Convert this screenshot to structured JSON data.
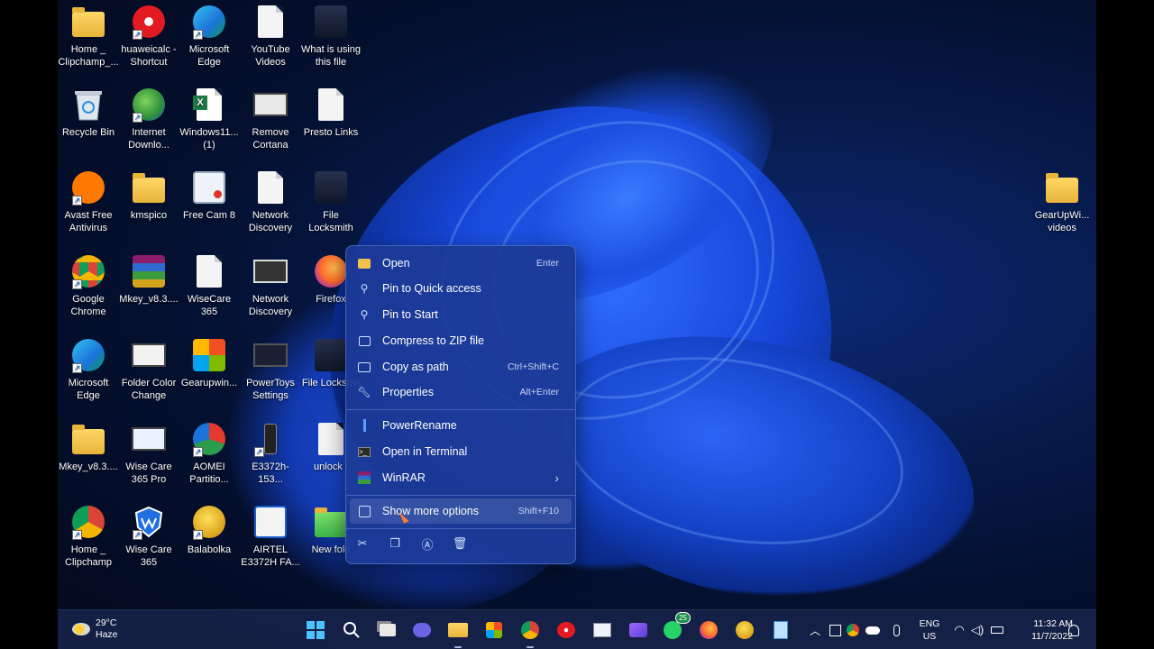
{
  "desktop": {
    "icons": [
      {
        "label": "Home _ Clipchamp_...",
        "icon": "folder-icon"
      },
      {
        "label": "huaweicalc - Shortcut",
        "icon": "huawei-icon"
      },
      {
        "label": "Microsoft Edge",
        "icon": "edge-icon"
      },
      {
        "label": "YouTube Videos",
        "icon": "document-icon"
      },
      {
        "label": "What is using this file",
        "icon": "app-icon"
      },
      {
        "label": "Recycle Bin",
        "icon": "recycle-bin-icon"
      },
      {
        "label": "Internet Downlo...",
        "icon": "idm-icon"
      },
      {
        "label": "Windows11... (1)",
        "icon": "excel-icon"
      },
      {
        "label": "Remove Cortana",
        "icon": "screen-icon"
      },
      {
        "label": "Presto Links",
        "icon": "document-icon"
      },
      {
        "label": "Avast Free Antivirus",
        "icon": "avast-icon"
      },
      {
        "label": "kmspico",
        "icon": "folder-icon"
      },
      {
        "label": "Free Cam 8",
        "icon": "freecam-icon"
      },
      {
        "label": "Network Discovery",
        "icon": "document-icon"
      },
      {
        "label": "File Locksmith",
        "icon": "app-icon"
      },
      {
        "label": "Google Chrome",
        "icon": "chrome-icon"
      },
      {
        "label": "Mkey_v8.3....",
        "icon": "winrar-icon"
      },
      {
        "label": "WiseCare 365",
        "icon": "document-icon"
      },
      {
        "label": "Network Discovery",
        "icon": "video-icon"
      },
      {
        "label": "Firefox",
        "icon": "firefox-icon"
      },
      {
        "label": "Microsoft Edge",
        "icon": "edge-icon"
      },
      {
        "label": "Folder Color Change",
        "icon": "screen-icon"
      },
      {
        "label": "Gearupwin...",
        "icon": "gearup-icon"
      },
      {
        "label": "PowerToys Settings",
        "icon": "screen-icon"
      },
      {
        "label": "File Locksmit",
        "icon": "app-icon"
      },
      {
        "label": "Mkey_v8.3....",
        "icon": "folder-icon"
      },
      {
        "label": "Wise Care 365 Pro",
        "icon": "screen-icon"
      },
      {
        "label": "AOMEI Partitio...",
        "icon": "aomei-icon"
      },
      {
        "label": "E3372h-153...",
        "icon": "modem-icon"
      },
      {
        "label": "unlock f",
        "icon": "document-icon"
      },
      {
        "label": "Home _ Clipchamp",
        "icon": "chrome-icon"
      },
      {
        "label": "Wise Care 365",
        "icon": "wisecare-icon"
      },
      {
        "label": "Balabolka",
        "icon": "balabolka-icon"
      },
      {
        "label": "AIRTEL E3372H FA...",
        "icon": "airtel-icon"
      },
      {
        "label": "New fold",
        "icon": "green-folder-icon"
      },
      {
        "label": "GearUpWi... videos",
        "icon": "folder-icon"
      }
    ]
  },
  "context_menu": {
    "items": [
      {
        "label": "Open",
        "shortcut": "Enter",
        "icon": "folder-open-icon"
      },
      {
        "label": "Pin to Quick access",
        "shortcut": "",
        "icon": "pin-icon"
      },
      {
        "label": "Pin to Start",
        "shortcut": "",
        "icon": "pin-icon"
      },
      {
        "label": "Compress to ZIP file",
        "shortcut": "",
        "icon": "zip-icon"
      },
      {
        "label": "Copy as path",
        "shortcut": "Ctrl+Shift+C",
        "icon": "path-icon"
      },
      {
        "label": "Properties",
        "shortcut": "Alt+Enter",
        "icon": "wrench-icon"
      },
      {
        "label": "PowerRename",
        "shortcut": "",
        "icon": "powerrename-icon"
      },
      {
        "label": "Open in Terminal",
        "shortcut": "",
        "icon": "terminal-icon"
      },
      {
        "label": "WinRAR",
        "shortcut": "",
        "icon": "winrar-icon"
      },
      {
        "label": "Show more options",
        "shortcut": "Shift+F10",
        "icon": "more-options-icon"
      }
    ],
    "winrar_arrow": "›",
    "bottom_actions": [
      "cut-icon",
      "copy-icon",
      "rename-icon",
      "delete-icon"
    ]
  },
  "taskbar": {
    "weather_temp": "29°C",
    "weather_desc": "Haze",
    "whatsapp_badge": "25",
    "lang_top": "ENG",
    "lang_bottom": "US",
    "time": "11:32 AM",
    "date": "11/7/2022"
  }
}
